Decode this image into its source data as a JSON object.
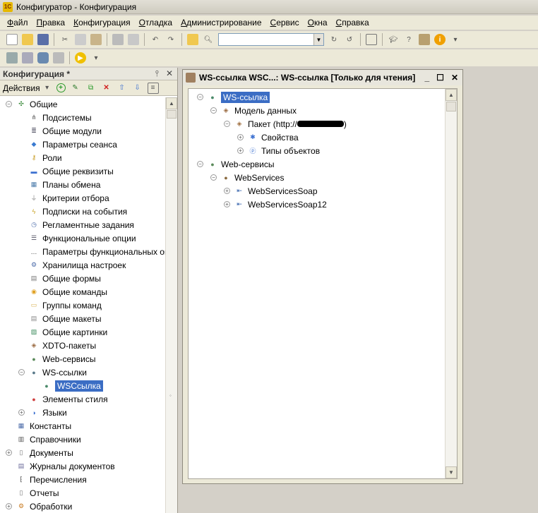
{
  "window": {
    "title": "Конфигуратор - Конфигурация"
  },
  "menu": [
    "Файл",
    "Правка",
    "Конфигурация",
    "Отладка",
    "Администрирование",
    "Сервис",
    "Окна",
    "Справка"
  ],
  "left_panel": {
    "title": "Конфигурация *",
    "actions_label": "Действия",
    "tree": [
      {
        "label": "Общие",
        "level": 0,
        "expander": "minus",
        "icon": "common-icon"
      },
      {
        "label": "Подсистемы",
        "level": 1,
        "expander": "none",
        "icon": "subsystems-icon"
      },
      {
        "label": "Общие модули",
        "level": 1,
        "expander": "none",
        "icon": "modules-icon"
      },
      {
        "label": "Параметры сеанса",
        "level": 1,
        "expander": "none",
        "icon": "session-params-icon"
      },
      {
        "label": "Роли",
        "level": 1,
        "expander": "none",
        "icon": "roles-icon"
      },
      {
        "label": "Общие реквизиты",
        "level": 1,
        "expander": "none",
        "icon": "attributes-icon"
      },
      {
        "label": "Планы обмена",
        "level": 1,
        "expander": "none",
        "icon": "exchange-plans-icon"
      },
      {
        "label": "Критерии отбора",
        "level": 1,
        "expander": "none",
        "icon": "filter-icon"
      },
      {
        "label": "Подписки на события",
        "level": 1,
        "expander": "none",
        "icon": "event-subscriptions-icon"
      },
      {
        "label": "Регламентные задания",
        "level": 1,
        "expander": "none",
        "icon": "scheduled-jobs-icon"
      },
      {
        "label": "Функциональные опции",
        "level": 1,
        "expander": "none",
        "icon": "functional-options-icon"
      },
      {
        "label": "Параметры функциональных опц",
        "level": 1,
        "expander": "none",
        "icon": "functional-params-icon"
      },
      {
        "label": "Хранилища настроек",
        "level": 1,
        "expander": "none",
        "icon": "settings-storage-icon"
      },
      {
        "label": "Общие формы",
        "level": 1,
        "expander": "none",
        "icon": "forms-icon"
      },
      {
        "label": "Общие команды",
        "level": 1,
        "expander": "none",
        "icon": "commands-icon"
      },
      {
        "label": "Группы команд",
        "level": 1,
        "expander": "none",
        "icon": "command-groups-icon"
      },
      {
        "label": "Общие макеты",
        "level": 1,
        "expander": "none",
        "icon": "templates-icon"
      },
      {
        "label": "Общие картинки",
        "level": 1,
        "expander": "none",
        "icon": "pictures-icon"
      },
      {
        "label": "XDTO-пакеты",
        "level": 1,
        "expander": "none",
        "icon": "xdto-icon"
      },
      {
        "label": "Web-сервисы",
        "level": 1,
        "expander": "none",
        "icon": "web-services-icon"
      },
      {
        "label": "WS-ссылки",
        "level": 1,
        "expander": "minus",
        "icon": "ws-links-icon"
      },
      {
        "label": "WSCсылка",
        "level": 2,
        "expander": "none",
        "icon": "ws-link-icon",
        "selected": true
      },
      {
        "label": "Элементы стиля",
        "level": 1,
        "expander": "none",
        "icon": "style-items-icon"
      },
      {
        "label": "Языки",
        "level": 1,
        "expander": "plus",
        "icon": "languages-icon"
      },
      {
        "label": "Константы",
        "level": 0,
        "expander": "none",
        "icon": "constants-icon"
      },
      {
        "label": "Справочники",
        "level": 0,
        "expander": "none",
        "icon": "catalogs-icon"
      },
      {
        "label": "Документы",
        "level": 0,
        "expander": "plus",
        "icon": "documents-icon"
      },
      {
        "label": "Журналы документов",
        "level": 0,
        "expander": "none",
        "icon": "journals-icon"
      },
      {
        "label": "Перечисления",
        "level": 0,
        "expander": "none",
        "icon": "enums-icon"
      },
      {
        "label": "Отчеты",
        "level": 0,
        "expander": "none",
        "icon": "reports-icon"
      },
      {
        "label": "Обработки",
        "level": 0,
        "expander": "plus",
        "icon": "processing-icon"
      }
    ]
  },
  "right_window": {
    "title": "WS-ссылка WSC...: WS-ссылка [Только для чтения]",
    "tree": [
      {
        "label": "WS-ссылка",
        "level": 0,
        "expander": "minus",
        "icon": "ws-link-icon",
        "selected": true
      },
      {
        "label": "Модель данных",
        "level": 1,
        "expander": "minus",
        "icon": "data-model-icon"
      },
      {
        "label": "Пакет (http://",
        "suffix": ")",
        "redacted": true,
        "level": 2,
        "expander": "minus",
        "icon": "package-icon"
      },
      {
        "label": "Свойства",
        "level": 3,
        "expander": "plus",
        "icon": "properties-icon"
      },
      {
        "label": "Типы объектов",
        "level": 3,
        "expander": "plus",
        "icon": "object-types-icon"
      },
      {
        "label": "Web-сервисы",
        "level": 0,
        "expander": "minus",
        "icon": "web-services-icon"
      },
      {
        "label": "WebServices",
        "level": 1,
        "expander": "minus",
        "icon": "web-service-icon"
      },
      {
        "label": "WebServicesSoap",
        "level": 2,
        "expander": "plus",
        "icon": "endpoint-icon"
      },
      {
        "label": "WebServicesSoap12",
        "level": 2,
        "expander": "plus",
        "icon": "endpoint-icon"
      }
    ]
  },
  "colors": {
    "selection": "#3b6dc4",
    "window_bg": "#d4d0c8",
    "panel_bg": "#ffffff"
  }
}
